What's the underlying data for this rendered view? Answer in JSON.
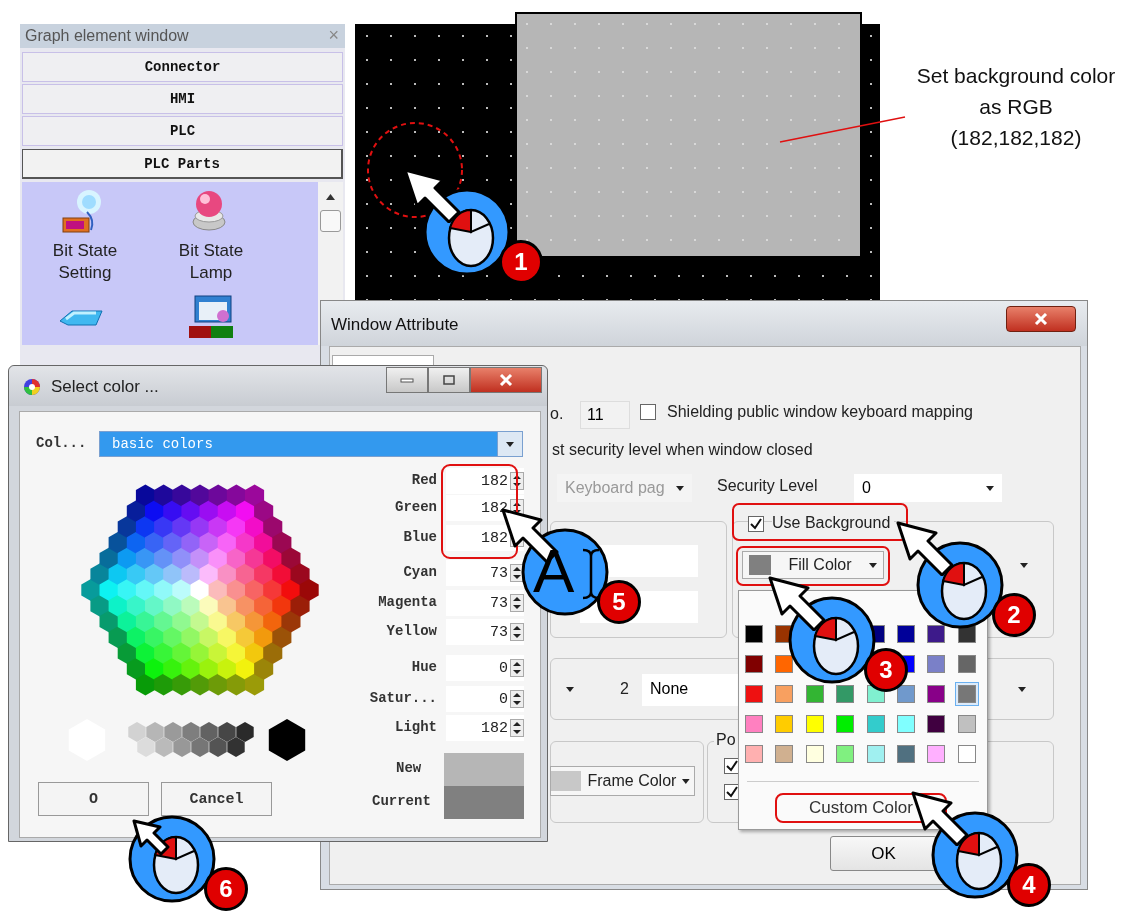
{
  "graph_element_window": {
    "title": "Graph element window",
    "close": "×",
    "sections": [
      {
        "label": "Connector",
        "selected": false
      },
      {
        "label": "HMI",
        "selected": false
      },
      {
        "label": "PLC",
        "selected": false
      },
      {
        "label": "PLC Parts",
        "selected": true
      }
    ],
    "parts": [
      {
        "label": "Bit State Setting"
      },
      {
        "label": "Bit State Lamp"
      }
    ]
  },
  "note": {
    "text": "Set background color\nas RGB\n(182,182,182)"
  },
  "window_attribute": {
    "title": "Window Attribute",
    "no_label": "o.",
    "no_value": "11",
    "shielding": {
      "label": "Shielding public window keyboard mapping",
      "checked": false
    },
    "security_note": "st security level when window closed",
    "keyboard_page": {
      "value": "Keyboard pag",
      "disabled": true
    },
    "security_level": {
      "label": "Security Level",
      "value": "0"
    },
    "use_background": {
      "label": "Use Background",
      "checked": true,
      "highlighted": true
    },
    "fill_color": {
      "label": "Fill Color",
      "highlighted": true
    },
    "index": "2",
    "pattern": "None",
    "frame_color": {
      "label": "Frame Color"
    },
    "popup_group": {
      "label": "Po",
      "options": [
        {
          "checked": true
        },
        {
          "checked": true
        }
      ]
    },
    "buttons": [
      "OK"
    ]
  },
  "color_menu": {
    "swatches": [
      {
        "color": "#000000",
        "selected": false
      },
      {
        "color": "#993300",
        "selected": false
      },
      {
        "color": "#000080",
        "selected": false
      },
      {
        "color": "#000099",
        "selected": false
      },
      {
        "color": "#3d1a8a",
        "selected": false
      },
      {
        "color": "#333333",
        "selected": false
      },
      {
        "color": "#800000",
        "selected": false
      },
      {
        "color": "#ff6600",
        "selected": false
      },
      {
        "color": "#0000ff",
        "selected": false
      },
      {
        "color": "#7a80c8",
        "selected": false
      },
      {
        "color": "#666666",
        "selected": false
      },
      {
        "color": "#ee1111",
        "selected": false
      },
      {
        "color": "#f8a060",
        "selected": false
      },
      {
        "color": "#33b533",
        "selected": false
      },
      {
        "color": "#339966",
        "selected": false
      },
      {
        "color": "#80f0d0",
        "selected": false
      },
      {
        "color": "#7099cc",
        "selected": false
      },
      {
        "color": "#880088",
        "selected": false
      },
      {
        "color": "#777777",
        "selected": true
      },
      {
        "color": "#ff80c0",
        "selected": false
      },
      {
        "color": "#ffcc00",
        "selected": false
      },
      {
        "color": "#ffff00",
        "selected": false
      },
      {
        "color": "#00ee00",
        "selected": false
      },
      {
        "color": "#33cccc",
        "selected": false
      },
      {
        "color": "#80ffff",
        "selected": false
      },
      {
        "color": "#400040",
        "selected": false
      },
      {
        "color": "#c0c0c0",
        "selected": false
      },
      {
        "color": "#ffb0b0",
        "selected": false
      },
      {
        "color": "#d0b090",
        "selected": false
      },
      {
        "color": "#ffffe0",
        "selected": false
      },
      {
        "color": "#80f080",
        "selected": false
      },
      {
        "color": "#a0f0f0",
        "selected": false
      },
      {
        "color": "#507080",
        "selected": false
      },
      {
        "color": "#ffb0ff",
        "selected": false
      },
      {
        "color": "#ffffff",
        "selected": false
      }
    ],
    "custom": {
      "label": "Custom Color",
      "highlighted": true
    }
  },
  "select_color": {
    "title": "Select color ...",
    "scheme_label": "Col...",
    "scheme": "basic colors",
    "fields": [
      {
        "label": "Red",
        "value": "182"
      },
      {
        "label": "Green",
        "value": "182"
      },
      {
        "label": "Blue",
        "value": "182"
      },
      {
        "label": "Cyan",
        "value": "73"
      },
      {
        "label": "Magenta",
        "value": "73"
      },
      {
        "label": "Yellow",
        "value": "73"
      },
      {
        "label": "Hue",
        "value": "0"
      },
      {
        "label": "Satur...",
        "value": "0"
      },
      {
        "label": "Light",
        "value": "182"
      }
    ],
    "rgb_highlighted": true,
    "new_label": "New",
    "current_label": "Current",
    "buttons": [
      "O",
      "Cancel"
    ]
  },
  "annotations": [
    {
      "kind": "mouse",
      "number": "1"
    },
    {
      "kind": "mouse",
      "number": "2"
    },
    {
      "kind": "mouse",
      "number": "3"
    },
    {
      "kind": "mouse",
      "number": "4"
    },
    {
      "kind": "text",
      "cursor": "A",
      "number": "5"
    },
    {
      "kind": "mouse",
      "number": "6"
    }
  ]
}
